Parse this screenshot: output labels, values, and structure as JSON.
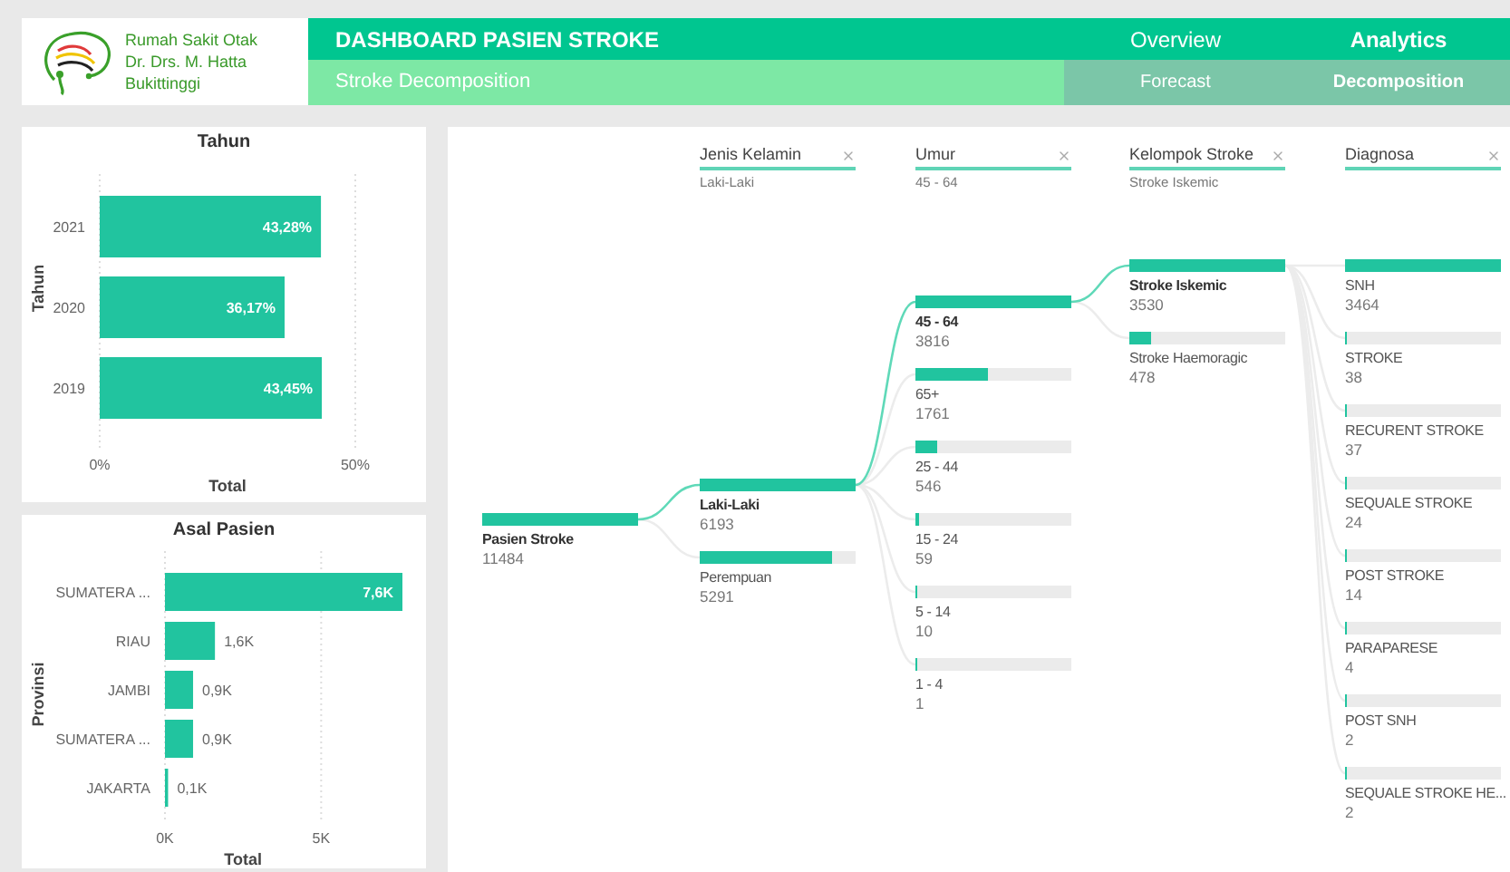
{
  "logo": {
    "lines": [
      "Rumah Sakit Otak",
      "Dr. Drs. M. Hatta",
      "Bukittinggi"
    ]
  },
  "header": {
    "title": "DASHBOARD PASIEN STROKE",
    "subtitle": "Stroke Decomposition"
  },
  "nav_tabs": [
    {
      "label": "Overview",
      "selected": false
    },
    {
      "label": "Analytics",
      "selected": true
    }
  ],
  "sub_tabs": [
    {
      "label": "Forecast",
      "selected": false
    },
    {
      "label": "Decomposition",
      "selected": true
    }
  ],
  "charts": [
    {
      "chart_data": {
        "type": "bar",
        "orientation": "horizontal",
        "title": "Tahun",
        "xlabel": "Total",
        "ylabel": "Tahun",
        "categories": [
          "2021",
          "2020",
          "2019"
        ],
        "values": [
          43.28,
          36.17,
          43.45
        ],
        "xlim": [
          0,
          50
        ],
        "xticks": [
          {
            "value": 0,
            "label": "0%"
          },
          {
            "value": 50,
            "label": "50%"
          }
        ],
        "value_labels": [
          "43,28%",
          "36,17%",
          "43,45%"
        ]
      }
    },
    {
      "chart_data": {
        "type": "bar",
        "orientation": "horizontal",
        "title": "Asal Pasien",
        "xlabel": "Total",
        "ylabel": "Provinsi",
        "categories": [
          "SUMATERA ...",
          "RIAU",
          "JAMBI",
          "SUMATERA ...",
          "JAKARTA"
        ],
        "values": [
          7600,
          1600,
          900,
          900,
          100
        ],
        "xlim": [
          0,
          7600
        ],
        "xticks": [
          {
            "value": 0,
            "label": "0K"
          },
          {
            "value": 5000,
            "label": "5K"
          }
        ],
        "value_labels": [
          "7,6K",
          "1,6K",
          "0,9K",
          "0,9K",
          "0,1K"
        ]
      }
    }
  ],
  "tree": {
    "root": {
      "label": "Pasien Stroke",
      "value": "11484",
      "level": 1,
      "selected": true
    },
    "columns": [
      {
        "header": "Jenis Kelamin",
        "filter": "Laki-Laki",
        "nodes": [
          {
            "label": "Laki-Laki",
            "value": "6193",
            "level": 1,
            "selected": true
          },
          {
            "label": "Perempuan",
            "value": "5291",
            "level": 0.85,
            "selected": false
          }
        ]
      },
      {
        "header": "Umur",
        "filter": "45 - 64",
        "nodes": [
          {
            "label": "45 - 64",
            "value": "3816",
            "level": 1,
            "selected": true
          },
          {
            "label": "65+",
            "value": "1761",
            "level": 0.46,
            "selected": false
          },
          {
            "label": "25 - 44",
            "value": "546",
            "level": 0.14,
            "selected": false
          },
          {
            "label": "15 - 24",
            "value": "59",
            "level": 0.02,
            "selected": false
          },
          {
            "label": "5 - 14",
            "value": "10",
            "level": 0.003,
            "selected": false
          },
          {
            "label": "1 - 4",
            "value": "1",
            "level": 0.0003,
            "selected": false
          }
        ]
      },
      {
        "header": "Kelompok Stroke",
        "filter": "Stroke Iskemic",
        "nodes": [
          {
            "label": "Stroke Iskemic",
            "value": "3530",
            "level": 1,
            "selected": true
          },
          {
            "label": "Stroke Haemoragic",
            "value": "478",
            "level": 0.14,
            "selected": false
          }
        ]
      },
      {
        "header": "Diagnosa",
        "nodes": [
          {
            "label": "SNH",
            "value": "3464",
            "level": 1,
            "selected": false
          },
          {
            "label": "STROKE",
            "value": "38",
            "level": 0.011,
            "selected": false
          },
          {
            "label": "RECURENT STROKE",
            "value": "37",
            "level": 0.011,
            "selected": false
          },
          {
            "label": "SEQUALE STROKE",
            "value": "24",
            "level": 0.007,
            "selected": false
          },
          {
            "label": "POST STROKE",
            "value": "14",
            "level": 0.004,
            "selected": false
          },
          {
            "label": "PARAPARESE",
            "value": "4",
            "level": 0.001,
            "selected": false
          },
          {
            "label": "POST SNH",
            "value": "2",
            "level": 0.0006,
            "selected": false
          },
          {
            "label": "SEQUALE STROKE HE...",
            "value": "2",
            "level": 0.0006,
            "selected": false
          }
        ]
      }
    ]
  }
}
